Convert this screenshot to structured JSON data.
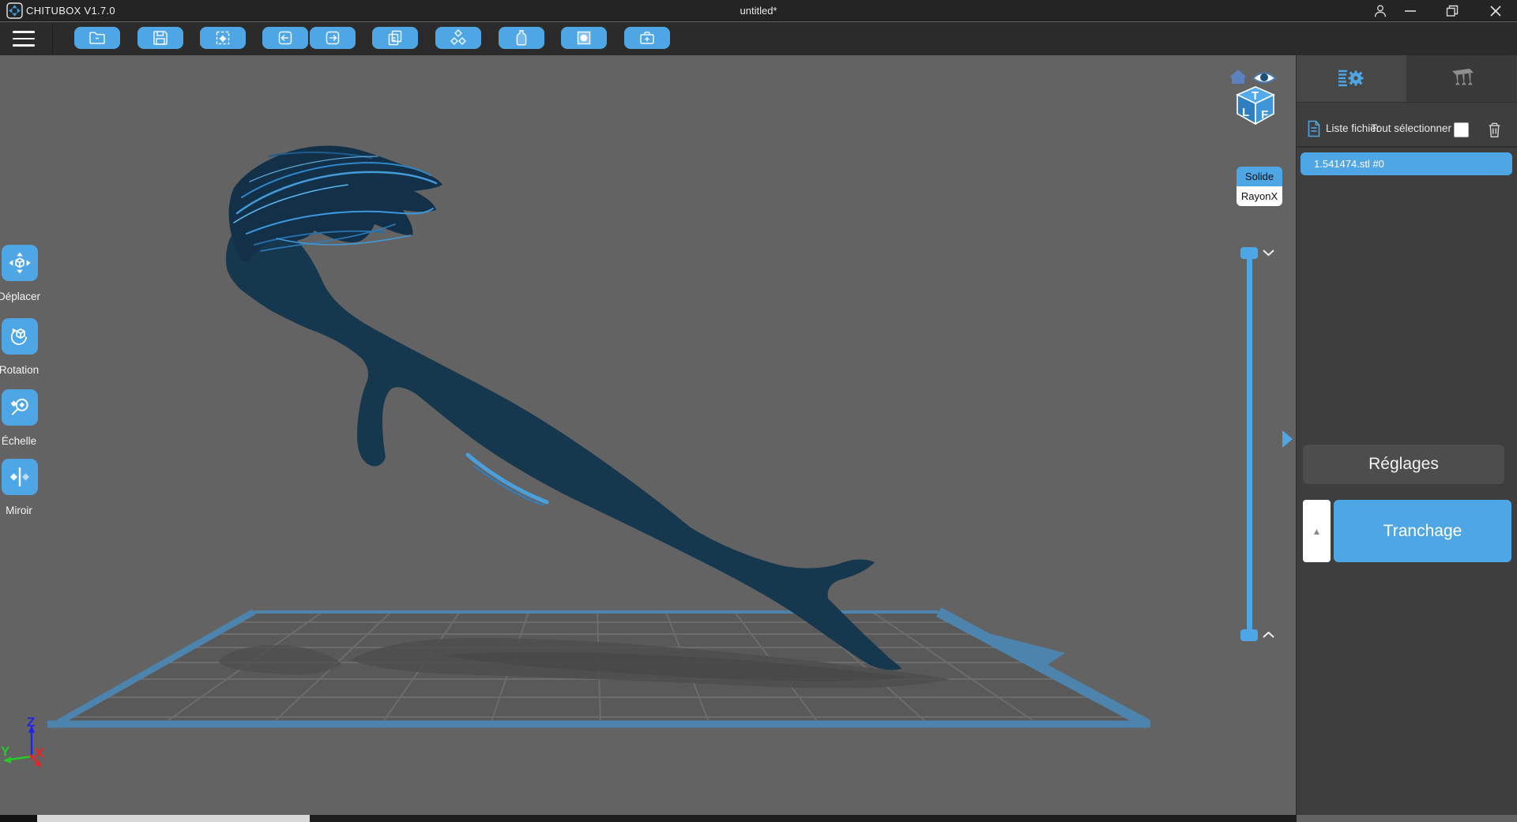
{
  "window": {
    "app_title": "CHITUBOX V1.7.0",
    "document_title": "untitled*"
  },
  "toolbar": {
    "buttons": [
      {
        "icon": "open-folder"
      },
      {
        "icon": "save"
      },
      {
        "icon": "screenshot"
      },
      {
        "icon": "undo"
      },
      {
        "icon": "redo"
      },
      {
        "icon": "copy"
      },
      {
        "icon": "hollow"
      },
      {
        "icon": "resin-bottle"
      },
      {
        "icon": "dig-hole"
      },
      {
        "icon": "repair"
      }
    ]
  },
  "tools": {
    "items": [
      {
        "label": "Déplacer",
        "icon": "move-icon"
      },
      {
        "label": "Rotation",
        "icon": "rotate-icon"
      },
      {
        "label": "Échelle",
        "icon": "scale-icon"
      },
      {
        "label": "Miroir",
        "icon": "mirror-icon"
      }
    ]
  },
  "view_toggle": {
    "solid": "Solide",
    "xray": "RayonX"
  },
  "viewcube": {
    "top": "T",
    "left": "L",
    "front": "F"
  },
  "axes": {
    "x": "X",
    "y": "Y",
    "z": "Z"
  },
  "right_panel": {
    "file_list_label": "Liste fichier",
    "select_all_label": "Tout sélectionner",
    "files": [
      {
        "name": "1.541474.stl #0"
      }
    ],
    "settings_button": "Réglages",
    "slice_button": "Tranchage",
    "up_arrow": "▲"
  },
  "colors": {
    "accent": "#4fa6e4",
    "model": "#16384f",
    "plate_border": "#4d84ad",
    "viewport_background": "#636363"
  }
}
